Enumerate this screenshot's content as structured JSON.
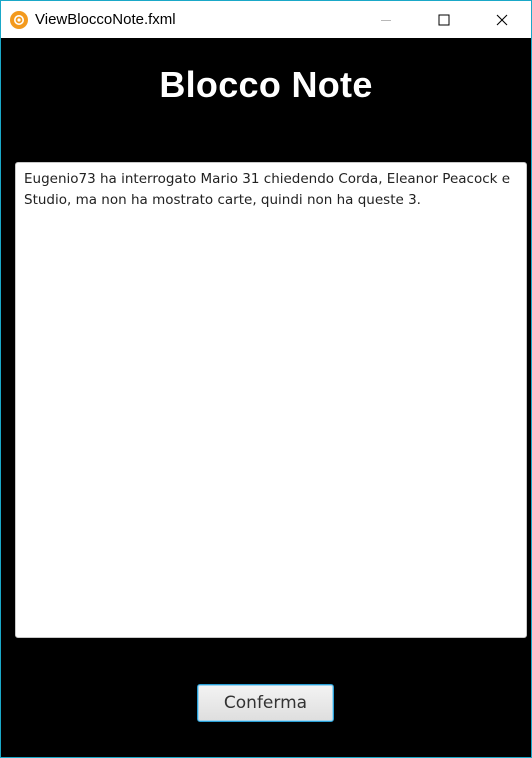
{
  "window": {
    "title": "ViewBloccoNote.fxml",
    "controls": {
      "minimize_icon": "minimize-icon",
      "maximize_icon": "maximize-icon",
      "close_icon": "close-icon"
    },
    "border_color": "#1aa8c8",
    "app_icon_color": "#f39a1e"
  },
  "main": {
    "title": "Blocco Note",
    "notes_text": "Eugenio73 ha interrogato Mario 31 chiedendo Corda, Eleanor Peacock e Studio, ma non ha mostrato carte, quindi non ha queste 3.",
    "confirm_label": "Conferma",
    "background_color": "#000000",
    "accent_color": "#2a9fd6"
  }
}
